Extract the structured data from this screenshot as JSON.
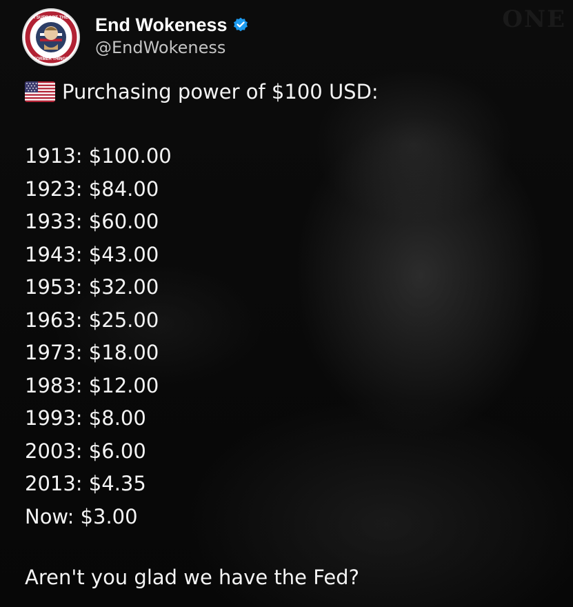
{
  "author": {
    "display_name": "End Wokeness",
    "handle": "@EndWokeness",
    "verified_icon": "verified-badge-icon",
    "avatar_text_top": "I SUPPORT THE",
    "avatar_text_bottom": "FORMER THINGS"
  },
  "tweet": {
    "flag_icon": "us-flag-icon",
    "headline": "Purchasing power of $100 USD:",
    "rows": [
      "1913: $100.00",
      "1923: $84.00",
      "1933: $60.00",
      "1943: $43.00",
      "1953: $32.00",
      "1963: $25.00",
      "1973: $18.00",
      "1983: $12.00",
      "1993: $8.00",
      "2003: $6.00",
      "2013: $4.35",
      "Now: $3.00"
    ],
    "closing": "Aren't you glad we have the Fed?"
  },
  "colors": {
    "background": "#080808",
    "text": "#f4f4f4",
    "handle": "#c4c4c4",
    "verified": "#1d9bf0"
  }
}
